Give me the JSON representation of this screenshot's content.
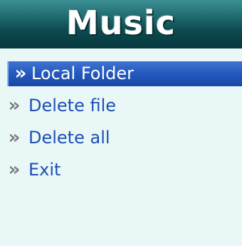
{
  "title": "Music",
  "menu": {
    "items": [
      {
        "label": "Local Folder",
        "selected": true,
        "icon": "double-chevron-right-icon"
      },
      {
        "label": "Delete file",
        "selected": false,
        "icon": "double-chevron-right-icon"
      },
      {
        "label": "Delete all",
        "selected": false,
        "icon": "double-chevron-right-icon"
      },
      {
        "label": "Exit",
        "selected": false,
        "icon": "double-chevron-right-icon"
      }
    ]
  },
  "colors": {
    "title_bar": "#0d4a50",
    "screen_bg": "#e9f7f6",
    "selected_bg": "#2358be",
    "item_text": "#1e4fb6"
  }
}
